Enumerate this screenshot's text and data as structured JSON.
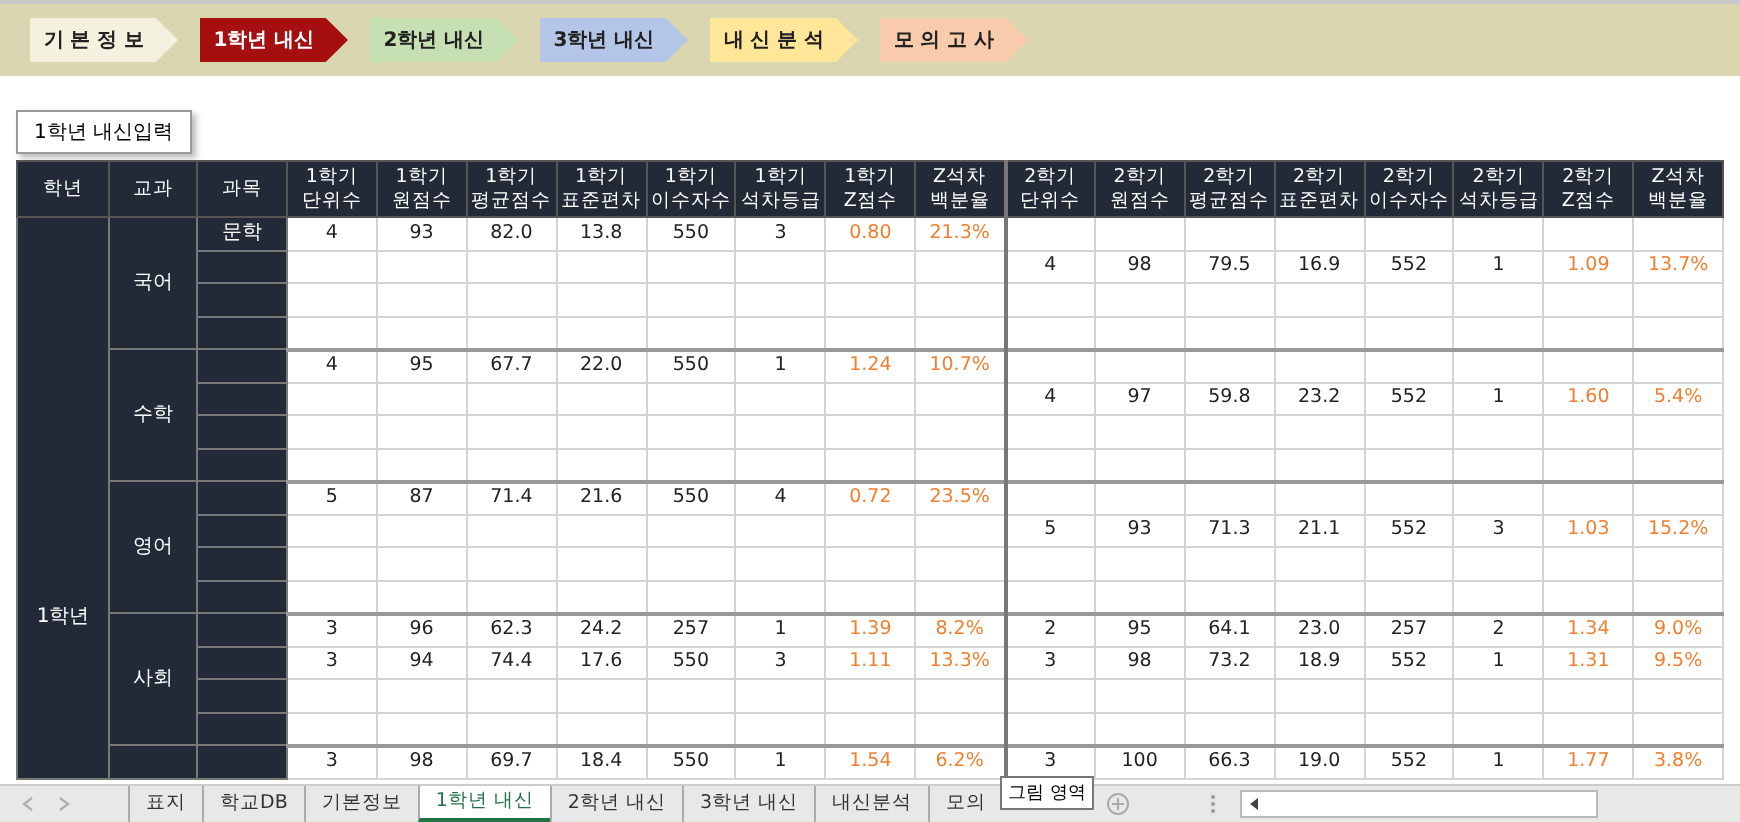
{
  "nav": [
    {
      "label": "기 본 정 보",
      "color": "#f4f1de",
      "selected": false
    },
    {
      "label": "1학년 내신",
      "color": "#a50f0f",
      "selected": true
    },
    {
      "label": "2학년 내신",
      "color": "#c6e0b4",
      "selected": false
    },
    {
      "label": "3학년 내신",
      "color": "#b4c6e7",
      "selected": false
    },
    {
      "label": "내 신 분 석",
      "color": "#ffe699",
      "selected": false
    },
    {
      "label": "모 의 고 사",
      "color": "#f8cbad",
      "selected": false
    }
  ],
  "section_label": "1학년 내신입력",
  "table": {
    "columns": [
      "학년",
      "교과",
      "과목",
      "1학기\n단위수",
      "1학기\n원점수",
      "1학기\n평균점수",
      "1학기\n표준편차",
      "1학기\n이수자수",
      "1학기\n석차등급",
      "1학기\nZ점수",
      "Z석차\n백분율",
      "2학기\n단위수",
      "2학기\n원점수",
      "2학기\n평균점수",
      "2학기\n표준편차",
      "2학기\n이수자수",
      "2학기\n석차등급",
      "2학기\nZ점수",
      "Z석차\n백분율"
    ],
    "grade": "1학년",
    "groups": [
      {
        "name": "국어",
        "rows": [
          {
            "course": "문학",
            "semester_1": [
              "4",
              "93",
              "82.0",
              "13.8",
              "550",
              "3",
              "0.80",
              "21.3%"
            ]
          },
          {
            "semester_2": [
              "4",
              "98",
              "79.5",
              "16.9",
              "552",
              "1",
              "1.09",
              "13.7%"
            ]
          },
          {},
          {}
        ]
      },
      {
        "name": "수학",
        "rows": [
          {
            "semester_1": [
              "4",
              "95",
              "67.7",
              "22.0",
              "550",
              "1",
              "1.24",
              "10.7%"
            ]
          },
          {
            "semester_2": [
              "4",
              "97",
              "59.8",
              "23.2",
              "552",
              "1",
              "1.60",
              "5.4%"
            ]
          },
          {},
          {}
        ]
      },
      {
        "name": "영어",
        "rows": [
          {
            "semester_1": [
              "5",
              "87",
              "71.4",
              "21.6",
              "550",
              "4",
              "0.72",
              "23.5%"
            ]
          },
          {
            "semester_2": [
              "5",
              "93",
              "71.3",
              "21.1",
              "552",
              "3",
              "1.03",
              "15.2%"
            ]
          },
          {},
          {}
        ]
      },
      {
        "name": "사회",
        "rows": [
          {
            "semester_1": [
              "3",
              "96",
              "62.3",
              "24.2",
              "257",
              "1",
              "1.39",
              "8.2%"
            ],
            "semester_2": [
              "2",
              "95",
              "64.1",
              "23.0",
              "257",
              "2",
              "1.34",
              "9.0%"
            ]
          },
          {
            "semester_1": [
              "3",
              "94",
              "74.4",
              "17.6",
              "550",
              "3",
              "1.11",
              "13.3%"
            ],
            "semester_2": [
              "3",
              "98",
              "73.2",
              "18.9",
              "552",
              "1",
              "1.31",
              "9.5%"
            ]
          },
          {},
          {}
        ]
      },
      {
        "rows": [
          {
            "semester_1": [
              "3",
              "98",
              "69.7",
              "18.4",
              "550",
              "1",
              "1.54",
              "6.2%"
            ],
            "semester_2": [
              "3",
              "100",
              "66.3",
              "19.0",
              "552",
              "1",
              "1.77",
              "3.8%"
            ]
          }
        ]
      }
    ]
  },
  "sheet_tabs": [
    {
      "label": "표지",
      "selected": false
    },
    {
      "label": "학교DB",
      "selected": false
    },
    {
      "label": "기본정보",
      "selected": false
    },
    {
      "label": "1학년 내신",
      "selected": true
    },
    {
      "label": "2학년 내신",
      "selected": false
    },
    {
      "label": "3학년 내신",
      "selected": false
    },
    {
      "label": "내신분석",
      "selected": false
    },
    {
      "label": "모의",
      "selected": false
    }
  ],
  "tooltip": "그림 영역"
}
